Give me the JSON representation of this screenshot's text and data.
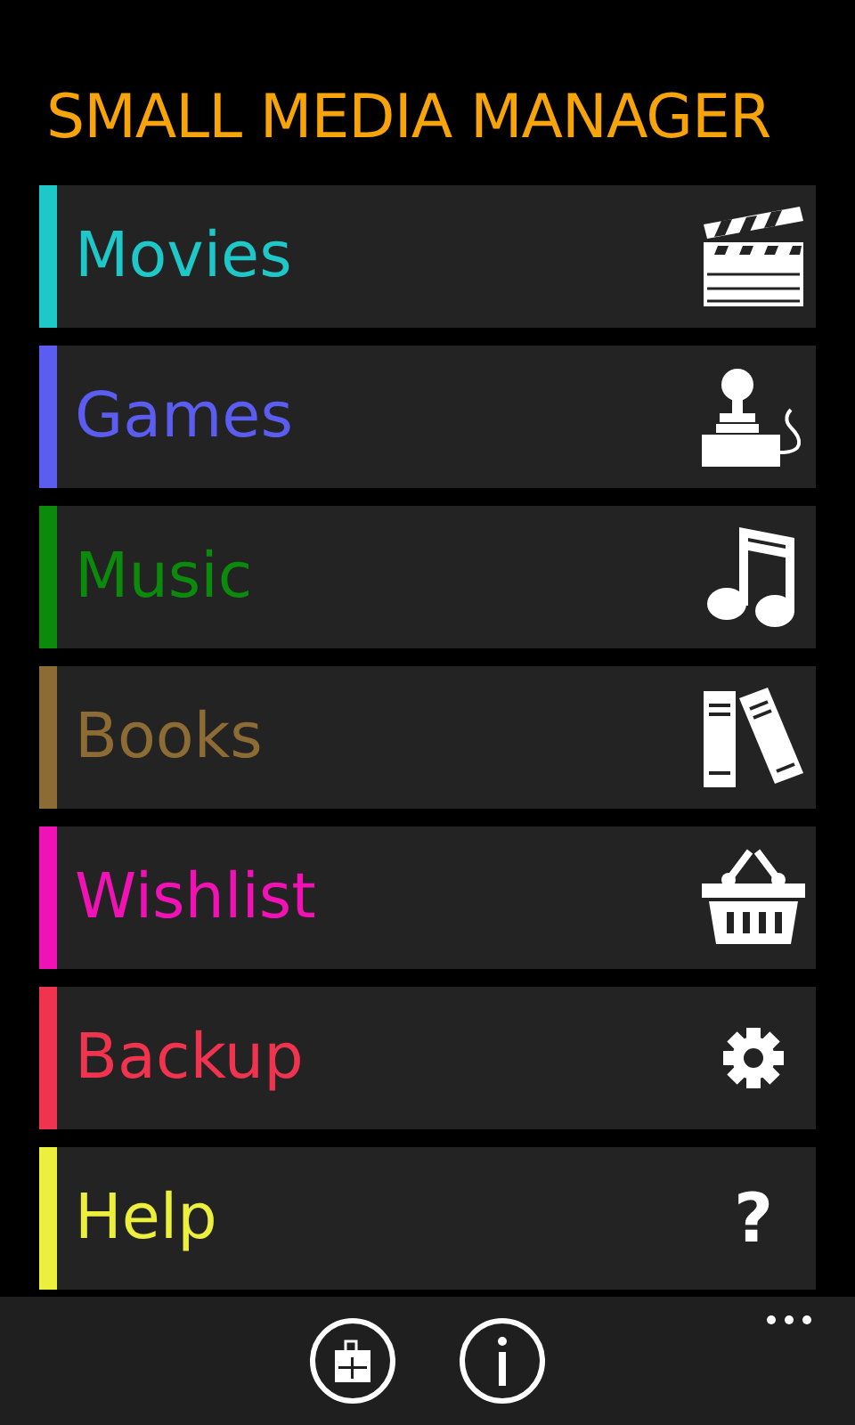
{
  "title": "SMALL MEDIA MANAGER",
  "items": [
    {
      "label": "Movies",
      "color": "#1ec8c8",
      "kind": "clapper"
    },
    {
      "label": "Games",
      "color": "#5b5cf0",
      "kind": "joystick"
    },
    {
      "label": "Music",
      "color": "#0b8a0b",
      "kind": "music"
    },
    {
      "label": "Books",
      "color": "#8d6b34",
      "kind": "books"
    },
    {
      "label": "Wishlist",
      "color": "#f012b4",
      "kind": "basket"
    },
    {
      "label": "Backup",
      "color": "#f0334f",
      "kind": "gear"
    },
    {
      "label": "Help",
      "color": "#ecef3c",
      "kind": "glyph",
      "glyph": "?"
    }
  ],
  "app_bar": {
    "buttons": [
      {
        "kind": "store"
      },
      {
        "kind": "info"
      }
    ]
  }
}
